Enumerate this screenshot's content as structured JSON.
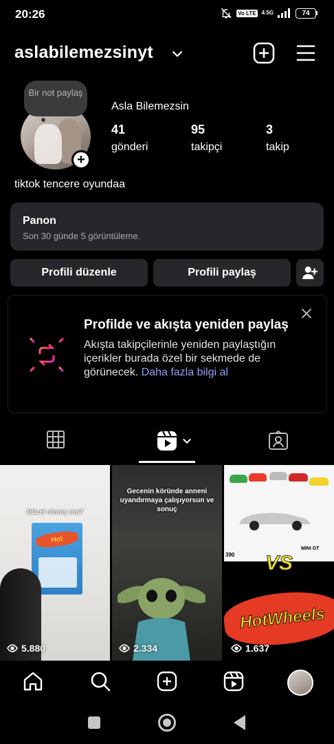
{
  "status_bar": {
    "time": "20:26",
    "volte": "Vo LTE",
    "network": "4.5G",
    "battery": "74",
    "icons": [
      "mute-icon",
      "signal-icon",
      "battery-icon"
    ]
  },
  "header": {
    "username": "aslabilemezsinyt",
    "icons": [
      "chevron-down-icon",
      "create-plus-icon",
      "hamburger-menu-icon"
    ]
  },
  "profile": {
    "note_text": "Bir not paylaş",
    "display_name": "Asla Bilemezsin",
    "stats": [
      {
        "value": "41",
        "label": "gönderi"
      },
      {
        "value": "95",
        "label": "takipçi"
      },
      {
        "value": "3",
        "label": "takip"
      }
    ],
    "bio": "tiktok tencere oyundaa"
  },
  "dashboard": {
    "title": "Panon",
    "subtitle": "Son 30 günde 5 görüntüleme."
  },
  "actions": {
    "edit_profile": "Profili düzenle",
    "share_profile": "Profili paylaş"
  },
  "reshare_card": {
    "title": "Profilde ve akışta yeniden paylaş",
    "body": "Akışta takipçilerinle yeniden paylaştığın içerikler burada özel bir sekmede de görünecek.",
    "link": "Daha fazla bilgi al"
  },
  "tabs": [
    "grid-icon",
    "reels-icon",
    "tagged-icon"
  ],
  "reels": [
    {
      "views": "5.880",
      "caption": "Güzel olmuş mu?"
    },
    {
      "views": "2.334",
      "caption": "Gecenin köründe anneni uyandırmaya çalışıyorsun ve sonuç"
    },
    {
      "views": "1.637",
      "caption": "",
      "vs_text": "VS",
      "brand_text": "HotWheels",
      "badge": "390",
      "mini_gt": "MINI GT"
    }
  ],
  "nav": [
    "home-icon",
    "search-icon",
    "create-icon",
    "reels-nav-icon",
    "profile-avatar"
  ],
  "colors": {
    "background": "#000000",
    "card": "#26272a",
    "link": "#8fa0f5"
  }
}
